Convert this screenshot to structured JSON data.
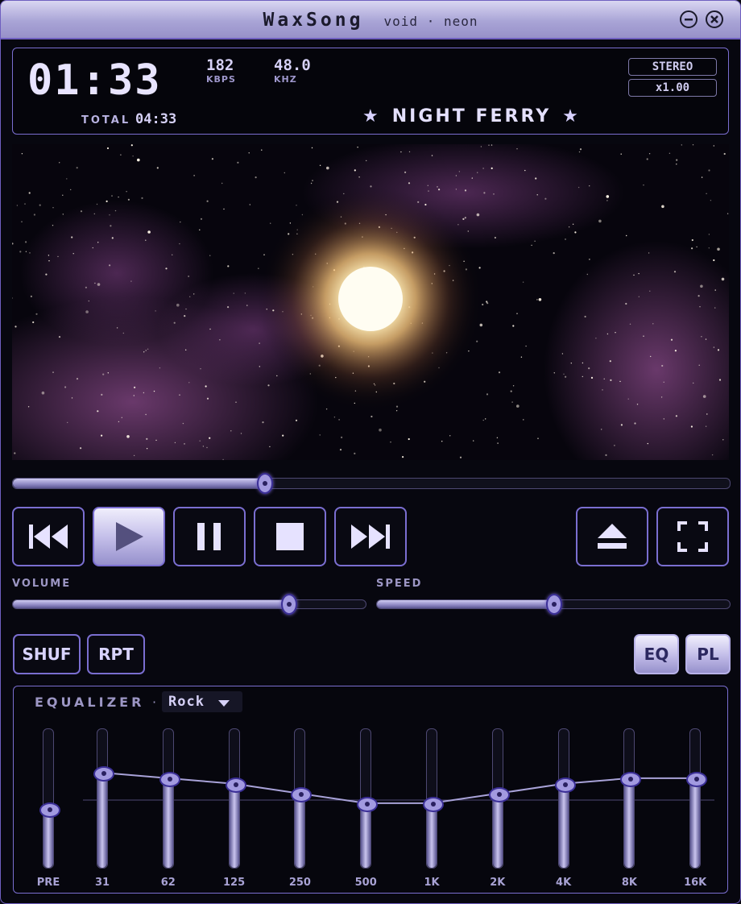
{
  "window": {
    "app_name": "WaxSong",
    "skin_name": "void · neon"
  },
  "display": {
    "time_minutes": "01",
    "time_seconds": "33",
    "bitrate": "182",
    "bitrate_unit": "KBPS",
    "samplerate": "48.0",
    "samplerate_unit": "KHZ",
    "total_label": "TOTAL",
    "total_time": "04:33",
    "channel_mode": "STEREO",
    "speed_multiplier": "x1.00",
    "track_title": "NIGHT FERRY",
    "star_glyph": "★"
  },
  "seek": {
    "progress": 0.35
  },
  "controls": {
    "buttons": [
      "previous-icon",
      "play-icon",
      "pause-icon",
      "stop-icon",
      "next-icon",
      "eject-icon",
      "fullscreen-icon"
    ],
    "active": "play-icon"
  },
  "volume": {
    "label": "VOLUME",
    "level": 0.78
  },
  "speed": {
    "label": "SPEED",
    "level": 0.5
  },
  "toggles": {
    "shuffle": "SHUF",
    "repeat": "RPT",
    "eq": "EQ",
    "playlist": "PL",
    "eq_on": true,
    "pl_on": true
  },
  "equalizer": {
    "title": "EQUALIZER",
    "separator": "·",
    "preset": "Rock",
    "preamp": {
      "label": "PRE",
      "level": 0.42
    },
    "bands": [
      {
        "label": "31",
        "level": 0.68
      },
      {
        "label": "62",
        "level": 0.64
      },
      {
        "label": "125",
        "level": 0.6
      },
      {
        "label": "250",
        "level": 0.53
      },
      {
        "label": "500",
        "level": 0.46
      },
      {
        "label": "1K",
        "level": 0.46
      },
      {
        "label": "2K",
        "level": 0.53
      },
      {
        "label": "4K",
        "level": 0.6
      },
      {
        "label": "8K",
        "level": 0.64
      },
      {
        "label": "16K",
        "level": 0.64
      }
    ]
  },
  "colors": {
    "accent": "#7a6ed0",
    "knob": "#a29ae0",
    "background": "#07070f"
  }
}
